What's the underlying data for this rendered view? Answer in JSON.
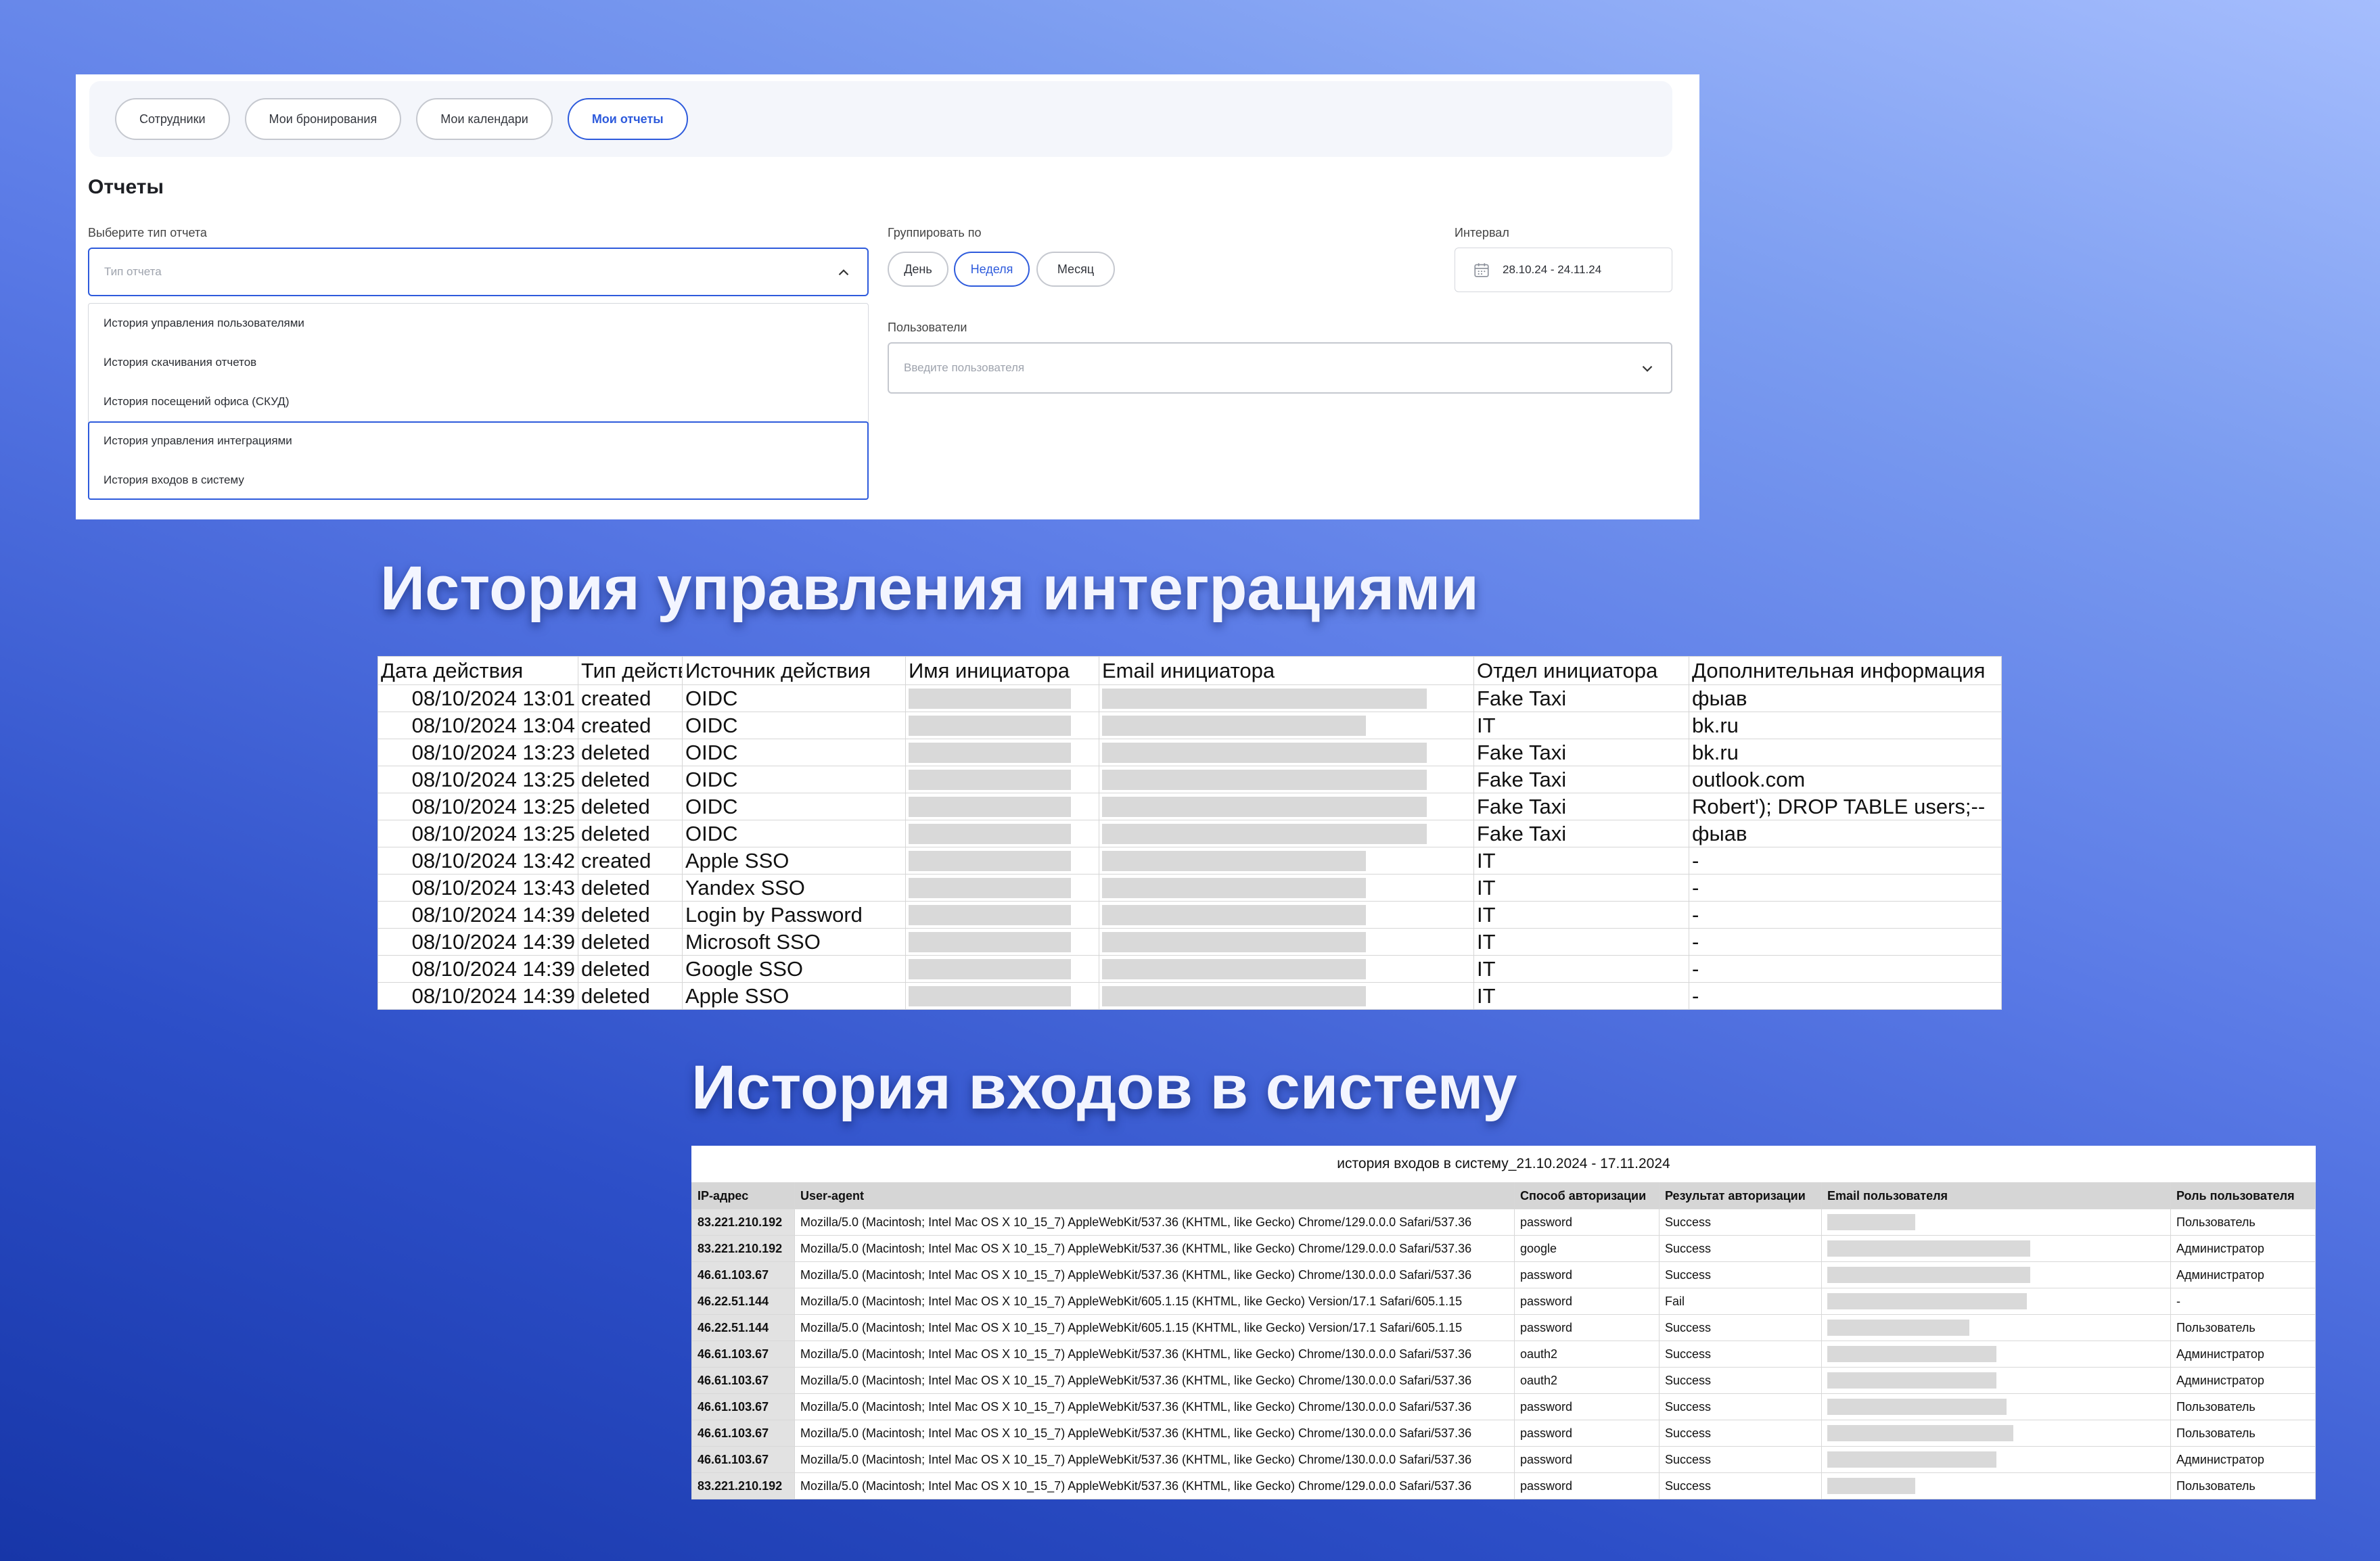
{
  "tabs": [
    {
      "label": "Сотрудники",
      "active": false
    },
    {
      "label": "Мои бронирования",
      "active": false
    },
    {
      "label": "Мои календари",
      "active": false
    },
    {
      "label": "Мои отчеты",
      "active": true
    }
  ],
  "reports": {
    "title": "Отчеты",
    "report_type": {
      "label": "Выберите тип отчета",
      "placeholder": "Тип отчета",
      "options": [
        "История управления пользователями",
        "История скачивания отчетов",
        "История посещений офиса (СКУД)",
        "История управления интеграциями",
        "История входов в систему"
      ]
    },
    "group_by": {
      "label": "Группировать по",
      "options": [
        "День",
        "Неделя",
        "Месяц"
      ],
      "selected": "Неделя"
    },
    "interval": {
      "label": "Интервал",
      "value": "28.10.24 - 24.11.24"
    },
    "users": {
      "label": "Пользователи",
      "placeholder": "Введите пользователя"
    }
  },
  "integrations_heading": "История управления интеграциями",
  "integrations_table": {
    "headers": [
      "Дата действия",
      "Тип действ",
      "Источник действия",
      "Имя инициатора",
      "Email инициатора",
      "Отдел инициатора",
      "Дополнительная информация"
    ],
    "rows": [
      {
        "date": "08/10/2024 13:01",
        "type": "created",
        "source": "OIDC",
        "dept": "Fake Taxi",
        "extra": "фыав"
      },
      {
        "date": "08/10/2024 13:04",
        "type": "created",
        "source": "OIDC",
        "dept": "IT",
        "extra": "bk.ru"
      },
      {
        "date": "08/10/2024 13:23",
        "type": "deleted",
        "source": "OIDC",
        "dept": "Fake Taxi",
        "extra": "bk.ru"
      },
      {
        "date": "08/10/2024 13:25",
        "type": "deleted",
        "source": "OIDC",
        "dept": "Fake Taxi",
        "extra": "outlook.com"
      },
      {
        "date": "08/10/2024 13:25",
        "type": "deleted",
        "source": "OIDC",
        "dept": "Fake Taxi",
        "extra": "Robert'); DROP TABLE users;--"
      },
      {
        "date": "08/10/2024 13:25",
        "type": "deleted",
        "source": "OIDC",
        "dept": "Fake Taxi",
        "extra": "фыав"
      },
      {
        "date": "08/10/2024 13:42",
        "type": "created",
        "source": "Apple SSO",
        "dept": "IT",
        "extra": "-"
      },
      {
        "date": "08/10/2024 13:43",
        "type": "deleted",
        "source": "Yandex SSO",
        "dept": "IT",
        "extra": "-"
      },
      {
        "date": "08/10/2024 14:39",
        "type": "deleted",
        "source": "Login by Password",
        "dept": "IT",
        "extra": "-"
      },
      {
        "date": "08/10/2024 14:39",
        "type": "deleted",
        "source": "Microsoft SSO",
        "dept": "IT",
        "extra": "-"
      },
      {
        "date": "08/10/2024 14:39",
        "type": "deleted",
        "source": "Google SSO",
        "dept": "IT",
        "extra": "-"
      },
      {
        "date": "08/10/2024 14:39",
        "type": "deleted",
        "source": "Apple SSO",
        "dept": "IT",
        "extra": "-"
      }
    ]
  },
  "logins_heading": "История входов в систему",
  "logins_table": {
    "caption": "история входов в систему_21.10.2024 - 17.11.2024",
    "headers": [
      "IP-адрес",
      "User-agent",
      "Способ авторизации",
      "Результат авторизации",
      "Email пользователя",
      "Роль пользователя"
    ],
    "rows": [
      {
        "ip": "83.221.210.192",
        "ua": "Mozilla/5.0 (Macintosh; Intel Mac OS X 10_15_7) AppleWebKit/537.36 (KHTML, like Gecko) Chrome/129.0.0.0 Safari/537.36",
        "method": "password",
        "result": "Success",
        "role": "Пользователь"
      },
      {
        "ip": "83.221.210.192",
        "ua": "Mozilla/5.0 (Macintosh; Intel Mac OS X 10_15_7) AppleWebKit/537.36 (KHTML, like Gecko) Chrome/129.0.0.0 Safari/537.36",
        "method": "google",
        "result": "Success",
        "role": "Администратор"
      },
      {
        "ip": "46.61.103.67",
        "ua": "Mozilla/5.0 (Macintosh; Intel Mac OS X 10_15_7) AppleWebKit/537.36 (KHTML, like Gecko) Chrome/130.0.0.0 Safari/537.36",
        "method": "password",
        "result": "Success",
        "role": "Администратор"
      },
      {
        "ip": "46.22.51.144",
        "ua": "Mozilla/5.0 (Macintosh; Intel Mac OS X 10_15_7) AppleWebKit/605.1.15 (KHTML, like Gecko) Version/17.1 Safari/605.1.15",
        "method": "password",
        "result": "Fail",
        "role": "-"
      },
      {
        "ip": "46.22.51.144",
        "ua": "Mozilla/5.0 (Macintosh; Intel Mac OS X 10_15_7) AppleWebKit/605.1.15 (KHTML, like Gecko) Version/17.1 Safari/605.1.15",
        "method": "password",
        "result": "Success",
        "role": "Пользователь"
      },
      {
        "ip": "46.61.103.67",
        "ua": "Mozilla/5.0 (Macintosh; Intel Mac OS X 10_15_7) AppleWebKit/537.36 (KHTML, like Gecko) Chrome/130.0.0.0 Safari/537.36",
        "method": "oauth2",
        "result": "Success",
        "role": "Администратор"
      },
      {
        "ip": "46.61.103.67",
        "ua": "Mozilla/5.0 (Macintosh; Intel Mac OS X 10_15_7) AppleWebKit/537.36 (KHTML, like Gecko) Chrome/130.0.0.0 Safari/537.36",
        "method": "oauth2",
        "result": "Success",
        "role": "Администратор"
      },
      {
        "ip": "46.61.103.67",
        "ua": "Mozilla/5.0 (Macintosh; Intel Mac OS X 10_15_7) AppleWebKit/537.36 (KHTML, like Gecko) Chrome/130.0.0.0 Safari/537.36",
        "method": "password",
        "result": "Success",
        "role": "Пользователь"
      },
      {
        "ip": "46.61.103.67",
        "ua": "Mozilla/5.0 (Macintosh; Intel Mac OS X 10_15_7) AppleWebKit/537.36 (KHTML, like Gecko) Chrome/130.0.0.0 Safari/537.36",
        "method": "password",
        "result": "Success",
        "role": "Пользователь"
      },
      {
        "ip": "46.61.103.67",
        "ua": "Mozilla/5.0 (Macintosh; Intel Mac OS X 10_15_7) AppleWebKit/537.36 (KHTML, like Gecko) Chrome/130.0.0.0 Safari/537.36",
        "method": "password",
        "result": "Success",
        "role": "Администратор"
      },
      {
        "ip": "83.221.210.192",
        "ua": "Mozilla/5.0 (Macintosh; Intel Mac OS X 10_15_7) AppleWebKit/537.36 (KHTML, like Gecko) Chrome/129.0.0.0 Safari/537.36",
        "method": "password",
        "result": "Success",
        "role": "Пользователь"
      }
    ]
  }
}
